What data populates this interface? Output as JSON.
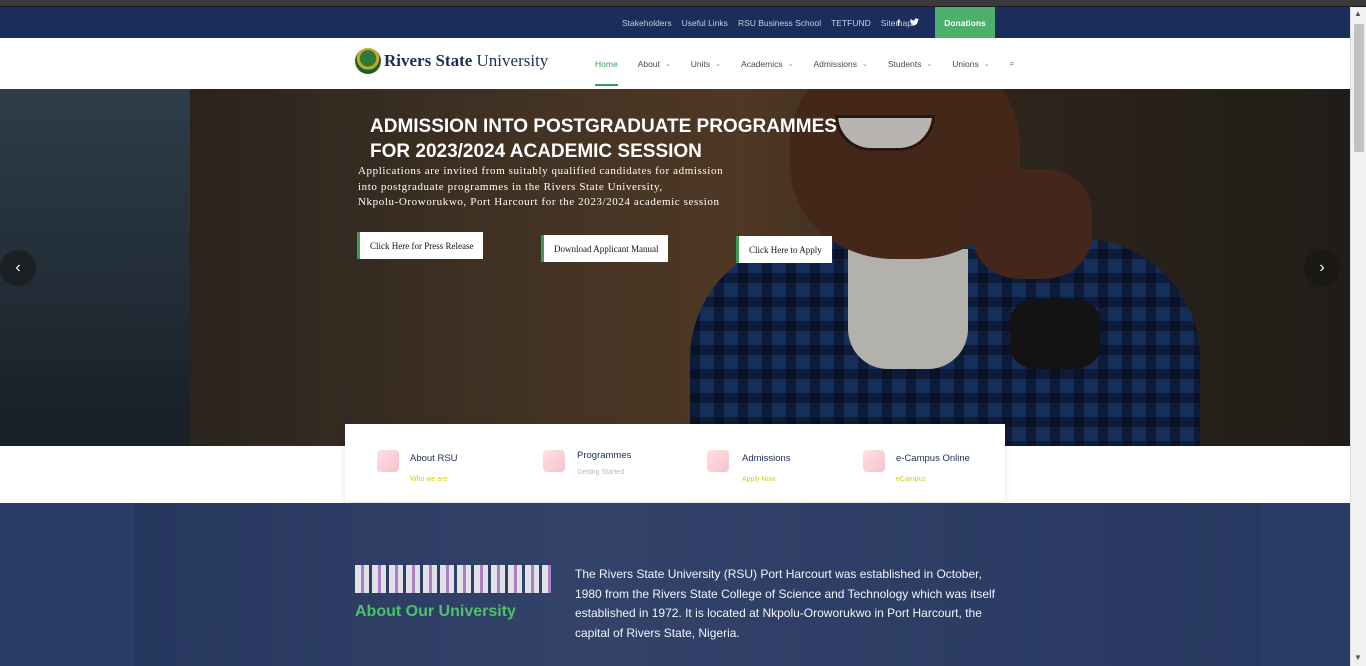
{
  "topbar": {
    "links": [
      "Stakeholders",
      "Useful Links",
      "RSU Business School",
      "TETFUND",
      "Sitemap"
    ],
    "social": [
      "f",
      "t"
    ],
    "donate": "Donations"
  },
  "logo": {
    "bold": "Rivers State",
    "regular": "University"
  },
  "nav": {
    "items": [
      {
        "label": "Home",
        "dropdown": false
      },
      {
        "label": "About",
        "dropdown": true
      },
      {
        "label": "Units",
        "dropdown": true
      },
      {
        "label": "Academics",
        "dropdown": true
      },
      {
        "label": "Admissions",
        "dropdown": true
      },
      {
        "label": "Students",
        "dropdown": true
      },
      {
        "label": "Unions",
        "dropdown": true
      }
    ],
    "active": "Home",
    "search_icon": "⌕"
  },
  "hero": {
    "title_line1": "ADMISSION INTO POSTGRADUATE PROGRAMMES",
    "title_line2": "FOR 2023/2024 ACADEMIC SESSION",
    "desc_line1": "Applications are invited from suitably qualified candidates for admission",
    "desc_line2": "into postgraduate programmes in the Rivers State University,",
    "desc_line3": "Nkpolu-Oroworukwo, Port Harcourt for the 2023/2024 academic session",
    "buttons": [
      "Click Here for Press Release",
      "Download Applicant Manual",
      "Click Here to Apply"
    ],
    "prev": "‹",
    "next": "›"
  },
  "quick_links": [
    {
      "title": "About RSU",
      "sub": "Who we are",
      "sub_color": "#d6d000"
    },
    {
      "title": "Programmes",
      "sub": "Getting Started",
      "sub_color": "#bbbbbb"
    },
    {
      "title": "Admissions",
      "sub": "Apply Now",
      "sub_color": "#d6d000"
    },
    {
      "title": "e-Campus Online",
      "sub": "eCampus",
      "sub_color": "#d6d000"
    }
  ],
  "about": {
    "heading": "About Our University",
    "text": "The Rivers State University (RSU) Port Harcourt was established in October, 1980 from the Rivers State College of Science and Technology which was itself established in 1972. It is located at Nkpolu-Oroworukwo in Port Harcourt, the capital of Rivers State, Nigeria."
  },
  "colors": {
    "navy": "#1b2d5a",
    "green": "#3d9a57",
    "about_heading": "#4cc26a"
  }
}
